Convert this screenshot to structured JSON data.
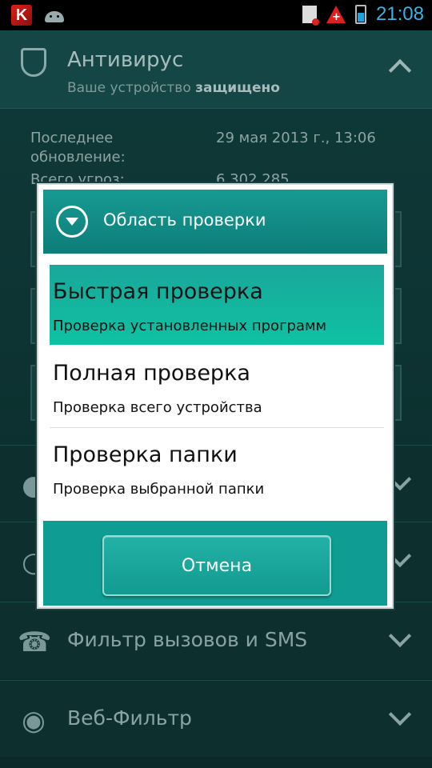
{
  "status_bar": {
    "time": "21:08"
  },
  "antivirus": {
    "title": "Антивирус",
    "subtitle_prefix": "Ваше устройство ",
    "subtitle_status": "защищено",
    "last_update_label_1": "Последнее",
    "last_update_label_2": "обновление:",
    "last_update_value": "29 мая 2013 г., 13:06",
    "threats_label": "Всего угроз:",
    "threats_value": "6 302 285"
  },
  "sections": [
    {
      "label": "Фильтр вызовов и SMS",
      "icon": "phone-icon"
    },
    {
      "label": "Веб-Фильтр",
      "icon": "globe-icon"
    }
  ],
  "dialog": {
    "title": "Область проверки",
    "options": [
      {
        "title": "Быстрая проверка",
        "desc": "Проверка установленных программ",
        "selected": true
      },
      {
        "title": "Полная проверка",
        "desc": "Проверка всего устройства",
        "selected": false
      },
      {
        "title": "Проверка папки",
        "desc": "Проверка выбранной папки",
        "selected": false
      }
    ],
    "cancel_label": "Отмена"
  }
}
